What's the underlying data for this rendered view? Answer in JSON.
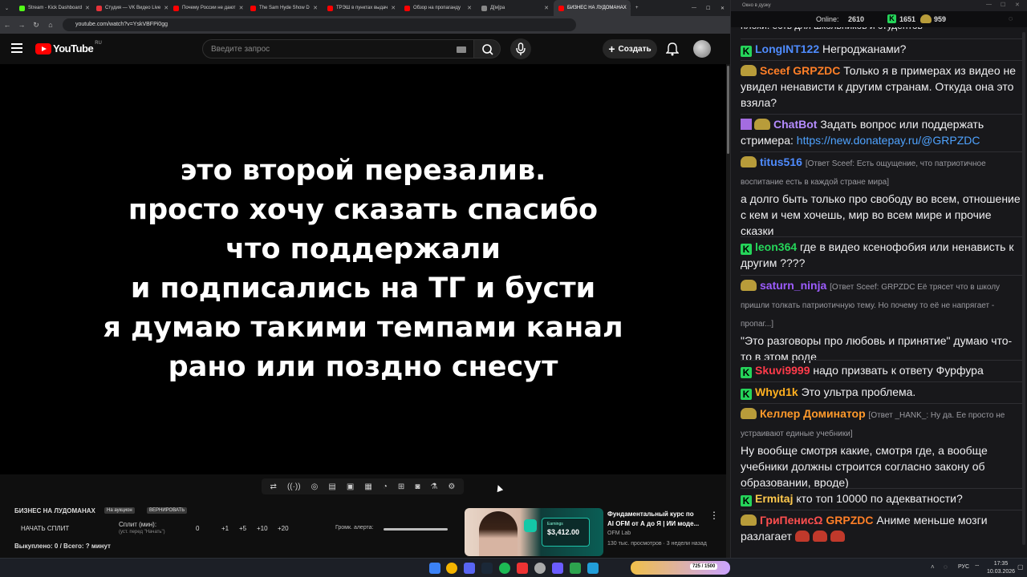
{
  "browser": {
    "tabs": [
      {
        "label": "Stream - Kick Dashboard",
        "color": "#53fc18"
      },
      {
        "label": "Студия — VK Видео Live",
        "color": "#e6333a"
      },
      {
        "label": "Почему России не дают",
        "color": "#ff0000"
      },
      {
        "label": "The Sam Hyde Show D",
        "color": "#ff0000"
      },
      {
        "label": "ТРЭШ в пунктах выдач",
        "color": "#ff0000"
      },
      {
        "label": "Обзор на пропаганду",
        "color": "#ff0000"
      },
      {
        "label": "Д[м]ра",
        "color": "#888888"
      },
      {
        "label": "БИЗНЕС НА ЛУДОМАНАХ",
        "color": "#ff0000",
        "active": true
      }
    ],
    "url": "youtube.com/watch?v=YskVBFPi0gg"
  },
  "youtube": {
    "logo_text": "YouTube",
    "region": "RU",
    "search_placeholder": "Введите запрос",
    "create_label": "Создать",
    "video_overlay_lines": [
      "это второй перезалив.",
      "просто хочу сказать спасибо",
      "что поддержали",
      "и подписались на ТГ и бусти",
      "я думаю такими темпами канал",
      "рано или поздно снесут"
    ]
  },
  "split_panel": {
    "title": "БИЗНЕС НА ЛУДОМАНАХ",
    "pill1": "На аукцион",
    "pill2": "ВЕРНИРОВАТЬ",
    "start_label": "НАЧАТЬ СПЛИТ",
    "split_label": "Сплит (мин):",
    "split_hint": "(уст. перед \"Начать\")",
    "split_value": "0",
    "increments": [
      "+1",
      "+5",
      "+10",
      "+20"
    ],
    "volume_label": "Громк. алерта:",
    "bought_text": "Выкуплено: 0 / Всего: ? минут"
  },
  "recommendation": {
    "title_line1": "Фундаментальный курс по",
    "title_line2": "AI OFM от А до Я | ИИ моде...",
    "channel": "OFM Lab",
    "meta": "130 тыс. просмотров · 3 недели назад",
    "thumb_amount": "$3,412.00",
    "thumb_caption": "Earnings"
  },
  "chat": {
    "window_title": "Окно в дуэку",
    "online_label": "Online:",
    "online_count": "2610",
    "kick_count": "1651",
    "emote_count": "959",
    "top_cut": "плохи: есть для школьников и студентов",
    "messages": [
      {
        "user": "LongINT122",
        "color": "#4f8cff",
        "badge": "kick",
        "text": "Негроджанами?"
      },
      {
        "user": "Sceef",
        "color": "#ff7f27",
        "badge": "emote",
        "tag": "GRPZDC",
        "tag_color": "#ff7f27",
        "text": "Только я в примерах из видео не увидел ненависти к другим странам. Откуда она это взяла?"
      },
      {
        "user": "ChatBot",
        "color": "#b58cff",
        "badge": "bot",
        "text": "Задать вопрос или поддержать стримера:",
        "link": "https://new.donatepay.ru/@GRPZDC"
      },
      {
        "user": "titus516",
        "color": "#4f8cff",
        "badge": "emote",
        "reply": "[Ответ Sceef: Есть ощущение, что патриотичное воспитание есть в каждой стране мира]",
        "text": "а долго быть только про свободу во всем, отношение с кем и чем хочешь, мир во всем мире и прочие сказки"
      },
      {
        "user": "leon364",
        "color": "#25d55a",
        "badge": "kick",
        "text": "где в видео ксенофобия или ненависть к другим ????"
      },
      {
        "user": "saturn_ninja",
        "color": "#9d5cff",
        "badge": "emote",
        "reply": "[Ответ Sceef: GRPZDC Её трясет что в школу пришли толкать патриотичную тему. Но почему то её не напрягает - пропаг...]",
        "text": "\"Это разговоры про любовь и принятие\" думаю что-то в этом роде"
      },
      {
        "user": "Skuvi9999",
        "color": "#ff3b4a",
        "badge": "kick",
        "text": "надо призвать к ответу Фурфура"
      },
      {
        "user": "Whyd1k",
        "color": "#ffb020",
        "badge": "kick",
        "text": "Это ультра проблема."
      },
      {
        "user": "Келлер Доминатор",
        "color": "#ff9a2b",
        "badge": "emote",
        "reply": "[Ответ _HANK_: Ну да. Ее просто не устраивают единые учебники]",
        "text": "Ну вообще смотря какие, смотря где, а вообще учебники должны строится согласно закону об образовании, вроде)"
      },
      {
        "user": "Ermitaj",
        "color": "#ffc94d",
        "badge": "kick",
        "text": "кто топ 10000 по адекватности?"
      },
      {
        "user": "ГриПенисΩ",
        "color": "#ff4f4f",
        "badge": "emote",
        "tag": "GRPZDC",
        "tag_color": "#ff7f27",
        "text": "Аниме меньше мозги разлагает"
      }
    ]
  },
  "taskbar": {
    "lang": "РУС",
    "time": "17:35",
    "date": "10.03.2026",
    "widget": "725 / 1500"
  }
}
